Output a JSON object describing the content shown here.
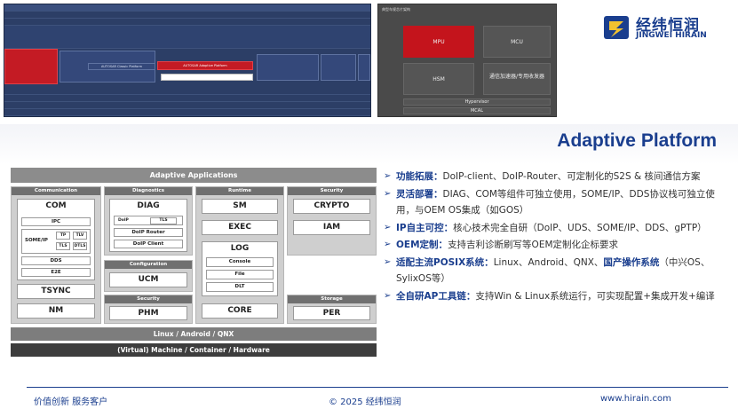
{
  "logo": {
    "cn": "经纬恒润",
    "en": "JINGWEI HIRAIN"
  },
  "title": "Adaptive Platform",
  "chip_diagram": {
    "title": "典型车规芯片架构",
    "mpu": "MPU",
    "mcu": "MCU",
    "hsm": "HSM",
    "accel": "通信加速器/专用收发器",
    "hypervisor": "Hypervisor",
    "mcal": "MCAL"
  },
  "arch_image": {
    "adaptive_platform_label": "AUTOSAR Adaptive Platform",
    "classic_platform_label": "AUTOSAR Classic Platform"
  },
  "diagram": {
    "apps": "Adaptive Applications",
    "communication": {
      "header": "Communication",
      "com": "COM",
      "ipc": "IPC",
      "someip": "SOME/IP",
      "tp": "TP",
      "tlv": "TLV",
      "tls": "TLS",
      "dtls": "DTLS",
      "dds": "DDS",
      "e2e": "E2E",
      "tsync": "TSYNC",
      "nm": "NM"
    },
    "diagnostics": {
      "header": "Diagnostics",
      "diag": "DIAG",
      "doip": "DoIP",
      "tls": "TLS",
      "router": "DoIP Router",
      "client": "DoIP Client"
    },
    "configuration": {
      "header": "Configuration",
      "ucm": "UCM"
    },
    "security_mid": {
      "header": "Security",
      "phm": "PHM"
    },
    "runtime": {
      "header": "Runtime",
      "sm": "SM",
      "exec": "EXEC",
      "log": "LOG",
      "console": "Console",
      "file": "File",
      "dlt": "DLT",
      "core": "CORE"
    },
    "security": {
      "header": "Security",
      "crypto": "CRYPTO",
      "iam": "IAM"
    },
    "storage": {
      "header": "Storage",
      "per": "PER"
    },
    "os": "Linux / Android / QNX",
    "vm": "(Virtual) Machine / Container / Hardware"
  },
  "bullets": [
    {
      "head": "功能拓展：",
      "text": "DoIP-client、DoIP-Router、可定制化的S2S & 核间通信方案"
    },
    {
      "head": "灵活部署：",
      "text": "DIAG、COM等组件可独立使用，SOME/IP、DDS协议栈可独立使用，与OEM OS集成（如GOS）"
    },
    {
      "head": "IP自主可控：",
      "text": "核心技术完全自研（DoIP、UDS、SOME/IP、DDS、gPTP）"
    },
    {
      "head": "OEM定制：",
      "text": "支持吉利诊断刷写等OEM定制化企标要求"
    },
    {
      "head": "适配主流POSIX系统：",
      "text": "Linux、Android、QNX、",
      "head2": "国产操作系统",
      "text2": "（中兴OS、SylixOS等）"
    },
    {
      "head": "全自研AP工具链：",
      "text": "支持Win & Linux系统运行，可实现配置+集成开发+编译"
    }
  ],
  "footer": {
    "left": "价值创新 服务客户",
    "center": "© 2025 经纬恒润",
    "right": "www.hirain.com"
  },
  "colors": {
    "brand": "#1a3e8e",
    "red": "#c4141c"
  }
}
